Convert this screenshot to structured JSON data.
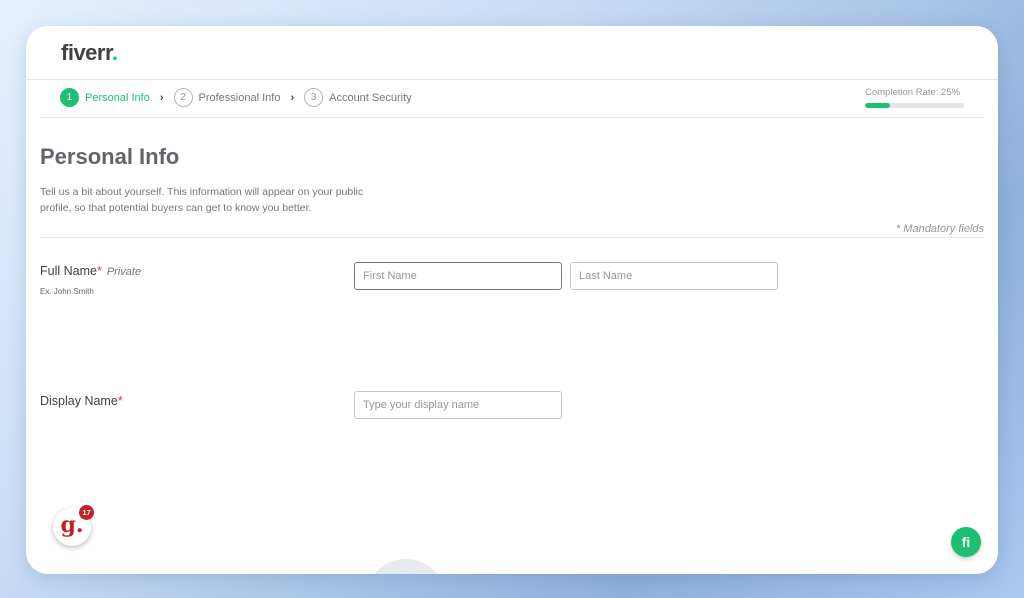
{
  "header": {
    "logo": "fiverr",
    "logo_dot": "."
  },
  "steps": [
    {
      "number": "1",
      "label": "Personal Info",
      "active": true
    },
    {
      "number": "2",
      "label": "Professional Info",
      "active": false
    },
    {
      "number": "3",
      "label": "Account Security",
      "active": false
    }
  ],
  "completion": {
    "label": "Completion Rate: 25%",
    "percent": 25
  },
  "page": {
    "title": "Personal Info",
    "description": "Tell us a bit about yourself. This information will appear on your public profile, so that potential buyers can get to know you better.",
    "mandatory_note": "* Mandatory fields"
  },
  "fields": {
    "full_name": {
      "label": "Full Name",
      "required_mark": "*",
      "private_label": "Private",
      "hint": "Ex. John Smith",
      "first_placeholder": "First Name",
      "last_placeholder": "Last Name"
    },
    "display_name": {
      "label": "Display Name",
      "required_mark": "*",
      "placeholder": "Type your display name"
    }
  },
  "widgets": {
    "grade_letter": "g.",
    "grade_count": "17",
    "help_icon_text": "fi"
  },
  "colors": {
    "accent": "#1dbf73",
    "required": "#e0313d",
    "grade_badge": "#c4202a"
  }
}
